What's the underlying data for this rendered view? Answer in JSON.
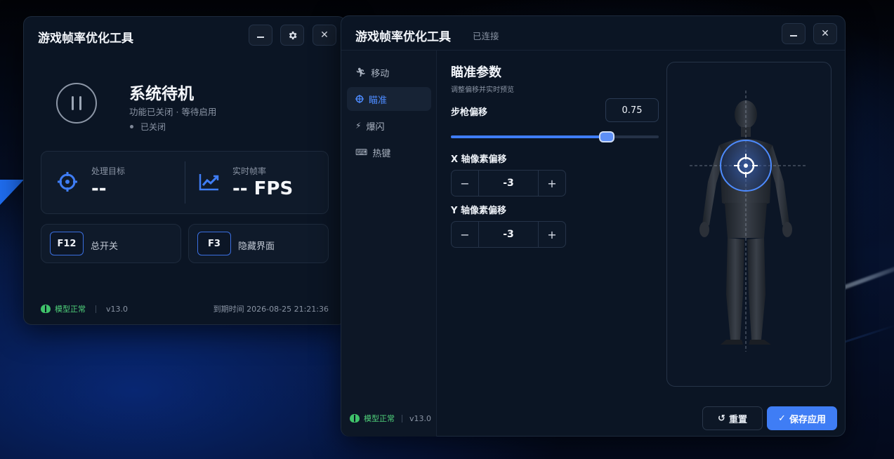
{
  "colors": {
    "accent": "#3f7df5",
    "ok": "#3fc26a",
    "window_bg": "#0b1524"
  },
  "window_left": {
    "title": "游戏帧率优化工具",
    "buttons": [
      "minimize",
      "settings",
      "close"
    ],
    "status": {
      "title": "系统待机",
      "subtitle": "功能已关闭 · 等待启用",
      "state": "已关闭"
    },
    "stats": {
      "target_label": "处理目标",
      "target_value": "--",
      "fps_label": "实时帧率",
      "fps_value": "-- FPS"
    },
    "hotkeys": [
      {
        "key": "F12",
        "label": "总开关"
      },
      {
        "key": "F3",
        "label": "隐藏界面"
      }
    ],
    "footer": {
      "model": "模型正常",
      "version": "v13.0",
      "expiry": "到期时间 2026-08-25 21:21:36"
    }
  },
  "window_right": {
    "title": "游戏帧率优化工具",
    "connection": "已连接",
    "nav": [
      {
        "icon": "run-icon",
        "label": "移动"
      },
      {
        "icon": "crosshair-icon",
        "label": "瞄准"
      },
      {
        "icon": "flash-icon",
        "label": "爆闪"
      },
      {
        "icon": "keyboard-icon",
        "label": "热键"
      }
    ],
    "active_nav": "瞄准",
    "section": {
      "title": "瞄准参数",
      "subtitle": "调整偏移并实时预览"
    },
    "rifle_offset": {
      "label": "步枪偏移",
      "value": "0.75",
      "slider_fraction": 0.75
    },
    "x_offset": {
      "label": "X 轴像素偏移",
      "value": "-3",
      "minus": "−",
      "plus": "+"
    },
    "y_offset": {
      "label": "Y 轴像素偏移",
      "value": "-3",
      "minus": "−",
      "plus": "+"
    },
    "buttons": {
      "reset": "重置",
      "save": "保存应用"
    },
    "footer": {
      "model": "模型正常",
      "version": "v13.0"
    }
  }
}
